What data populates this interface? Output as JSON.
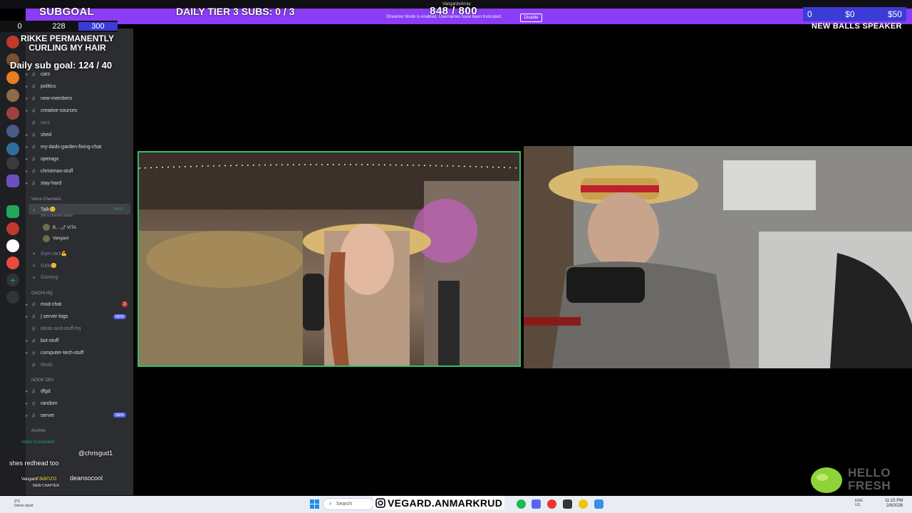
{
  "overlay": {
    "subgoal_label": "SUBGOAL",
    "tier3_label": "DAILY TIER 3 SUBS: 0 / 3",
    "center_count": "848 / 800",
    "center_user": "VangardxArray",
    "streamer_mode_text": "Streamer Mode is enabled. Usernames have been truncated.",
    "disable_label": "Disable",
    "donation_counts": [
      "0",
      "$0",
      "$50"
    ],
    "right_title": "NEW BALLS SPEAKER",
    "left_counter": [
      "0",
      "228",
      "300"
    ],
    "rikke_text": "RIKKE PERMANENTLY CURLING MY HAIR",
    "daily_sub_goal": "Daily sub goal: 124 / 40"
  },
  "discord": {
    "channels": [
      {
        "name": "cars",
        "muted": false
      },
      {
        "name": "politics",
        "muted": false
      },
      {
        "name": "new-members",
        "muted": false
      },
      {
        "name": "creative-sources",
        "muted": false
      },
      {
        "name": "osrs",
        "muted": true
      },
      {
        "name": "shed",
        "muted": false
      },
      {
        "name": "my-dads-garden-fixing-chat",
        "muted": false
      },
      {
        "name": "operagx",
        "muted": false
      },
      {
        "name": "christmas-stuff",
        "muted": false
      },
      {
        "name": "stay-hard",
        "muted": false
      }
    ],
    "voice_category": "Voice Channels",
    "talk_channel": "Talk😊",
    "talk_status": "Set a channel status",
    "talk_time": "54:53",
    "voice_users": [
      "B... 🌶 VITA",
      "Vangard"
    ],
    "other_voice": [
      "Gym rant💪",
      "Girls😊",
      "Gaming"
    ],
    "gachi_category": "GACHI HQ",
    "gachi_channels": [
      {
        "name": "mod-chat",
        "muted": false
      },
      {
        "name": "| server-logs",
        "muted": false
      },
      {
        "name": "ideas-and-stuff-hq",
        "muted": true
      },
      {
        "name": "bot-stuff",
        "muted": false
      },
      {
        "name": "computer-tech-stuff",
        "muted": false
      },
      {
        "name": "Mods",
        "muted": true
      }
    ],
    "mod_chat_badge": "2",
    "new_badge": "NEW",
    "nook_category": "NOOK DEV",
    "nook_channels": [
      "dfgd",
      "random",
      "server"
    ],
    "archive_category": "Archive",
    "video_connected": "Video Connected",
    "vc_sub": "Talk / VangardxArray"
  },
  "chat": [
    {
      "user": "",
      "text": "@chrisgud1"
    },
    {
      "user": "",
      "text": "shes redhead too"
    },
    {
      "user": "raanzo",
      "text": "deansocool"
    },
    {
      "user": "Vangard",
      "text": "NEW CHAPTER"
    }
  ],
  "taskbar": {
    "search_placeholder": "Search",
    "instagram_name": "VEGARD.ANMARKRUD",
    "time": "11:15 PM",
    "date": "2/9/2026",
    "weather": "9°C",
    "weather_sub": "Delvis skyet",
    "lang": "ENG US"
  },
  "sponsor": {
    "line1": "HELLO",
    "line2": "FRESH"
  },
  "colors": {
    "overlay_purple": "#8b3cf7",
    "donation_blue": "#3b3bd6",
    "cam_border": "#2fbf6a"
  }
}
